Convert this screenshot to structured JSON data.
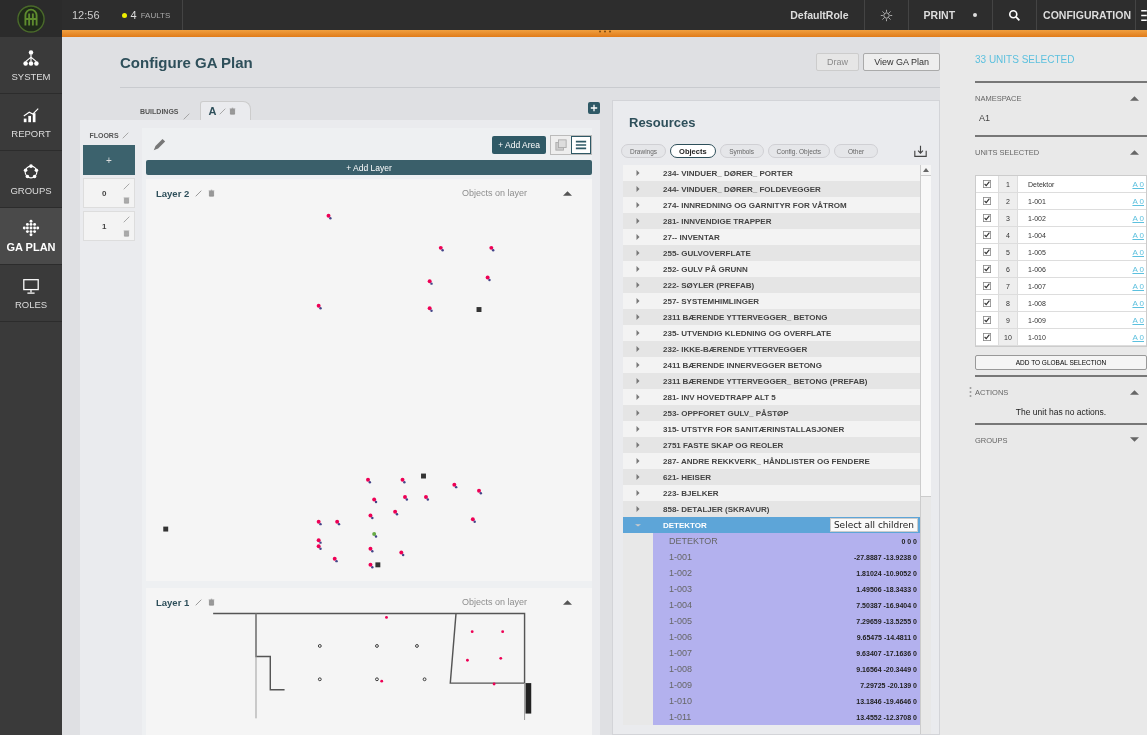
{
  "topbar": {
    "time": "12:56",
    "faults": {
      "count": "4",
      "label": "FAULTS"
    },
    "role": "DefaultRole",
    "print": "PRINT",
    "configuration": "CONFIGURATION"
  },
  "nav": [
    {
      "label": "SYSTEM",
      "kind": "system",
      "selected": false
    },
    {
      "label": "REPORT",
      "kind": "report",
      "selected": false
    },
    {
      "label": "GROUPS",
      "kind": "groups",
      "selected": false
    },
    {
      "label": "GA PLAN",
      "kind": "gaplan",
      "selected": true
    },
    {
      "label": "ROLES",
      "kind": "roles",
      "selected": false
    }
  ],
  "page": {
    "title": "Configure GA Plan",
    "buttons": [
      {
        "label": "Draw",
        "disabled": true
      },
      {
        "label": "View GA Plan",
        "disabled": false
      }
    ]
  },
  "buildings": {
    "label": "BUILDINGS",
    "tabs": [
      {
        "label": "A",
        "selected": true
      }
    ]
  },
  "floors": {
    "label": "FLOORS",
    "add": "+",
    "items": [
      {
        "label": "0"
      },
      {
        "label": "1"
      }
    ]
  },
  "toolbar": {
    "add_area": "+ Add Area",
    "add_layer": "+ Add Layer",
    "view_modes": [
      {
        "kind": "copy",
        "selected": false
      },
      {
        "kind": "list",
        "selected": true
      }
    ]
  },
  "layers": [
    {
      "name": "Layer 2",
      "hint": "Objects on layer",
      "expanded": true,
      "kind": "markers"
    },
    {
      "name": "Layer 1",
      "hint": "Objects on layer",
      "expanded": true,
      "kind": "plan"
    }
  ],
  "resources": {
    "title": "Resources",
    "tabs": [
      {
        "label": "Drawings",
        "selected": false
      },
      {
        "label": "Objects",
        "selected": true
      },
      {
        "label": "Symbols",
        "selected": false
      },
      {
        "label": "Config. Objects",
        "selected": false
      },
      {
        "label": "Other",
        "selected": false
      }
    ],
    "items": [
      {
        "name": "234- VINDUER_ DØRER_ PORTER",
        "expanded": false
      },
      {
        "name": "244- VINDUER_ DØRER_ FOLDEVEGGER",
        "expanded": false
      },
      {
        "name": "274- INNREDNING OG GARNITYR FOR VÅTROM",
        "expanded": false
      },
      {
        "name": "281- INNVENDIGE TRAPPER",
        "expanded": false
      },
      {
        "name": "27-- INVENTAR",
        "expanded": false
      },
      {
        "name": "255- GULVOVERFLATE",
        "expanded": false
      },
      {
        "name": "252- GULV PÅ GRUNN",
        "expanded": false
      },
      {
        "name": "222- SØYLER (PREFAB)",
        "expanded": false
      },
      {
        "name": "257- SYSTEMHIMLINGER",
        "expanded": false
      },
      {
        "name": "2311 BÆRENDE YTTERVEGGER_ BETONG",
        "expanded": false
      },
      {
        "name": "235- UTVENDIG KLEDNING OG OVERFLATE",
        "expanded": false
      },
      {
        "name": "232- IKKE-BÆRENDE YTTERVEGGER",
        "expanded": false
      },
      {
        "name": "2411 BÆRENDE INNERVEGGER BETONG",
        "expanded": false
      },
      {
        "name": "2311 BÆRENDE YTTERVEGGER_ BETONG (PREFAB)",
        "expanded": false
      },
      {
        "name": "281- INV HOVEDTRAPP ALT 5",
        "expanded": false
      },
      {
        "name": "253- OPPFORET GULV_ PÅSTØP",
        "expanded": false
      },
      {
        "name": "315- UTSTYR FOR SANITÆRINSTALLASJONER",
        "expanded": false
      },
      {
        "name": "2751 FASTE SKAP OG REOLER",
        "expanded": false
      },
      {
        "name": "287- ANDRE REKKVERK_ HÅNDLISTER OG FENDERE",
        "expanded": false
      },
      {
        "name": "621- HEISER",
        "expanded": false
      },
      {
        "name": "223- BJELKER",
        "expanded": false
      },
      {
        "name": "858- DETALJER (SKRAVUR)",
        "expanded": false
      },
      {
        "name": "DETEKTOR",
        "expanded": true,
        "action": "Select all children",
        "children": [
          {
            "name": "DETEKTOR",
            "coords": "0 0 0"
          },
          {
            "name": "1-001",
            "coords": "-27.8887 -13.9238 0"
          },
          {
            "name": "1-002",
            "coords": "1.81024 -10.9052 0"
          },
          {
            "name": "1-003",
            "coords": "1.49506 -18.3433 0"
          },
          {
            "name": "1-004",
            "coords": "7.50387 -16.9404 0"
          },
          {
            "name": "1-005",
            "coords": "7.29659 -13.5255 0"
          },
          {
            "name": "1-006",
            "coords": "9.65475 -14.4811 0"
          },
          {
            "name": "1-007",
            "coords": "9.63407 -17.1636 0"
          },
          {
            "name": "1-008",
            "coords": "9.16564 -20.3449 0"
          },
          {
            "name": "1-009",
            "coords": "7.29725 -20.139 0"
          },
          {
            "name": "1-010",
            "coords": "13.1846 -19.4646 0"
          },
          {
            "name": "1-011",
            "coords": "13.4552 -12.3708 0"
          }
        ]
      }
    ]
  },
  "selection": {
    "title": "33 UNITS SELECTED",
    "namespace": {
      "label": "NAMESPACE",
      "expanded": true,
      "value": "A1"
    },
    "units": {
      "label": "UNITS SELECTED",
      "expanded": true,
      "rows": [
        {
          "checked": true,
          "index": "1",
          "name": "Detektor",
          "link": "A 0"
        },
        {
          "checked": true,
          "index": "2",
          "name": "1-001",
          "link": "A 0"
        },
        {
          "checked": true,
          "index": "3",
          "name": "1-002",
          "link": "A 0"
        },
        {
          "checked": true,
          "index": "4",
          "name": "1-004",
          "link": "A 0"
        },
        {
          "checked": true,
          "index": "5",
          "name": "1-005",
          "link": "A 0"
        },
        {
          "checked": true,
          "index": "6",
          "name": "1-006",
          "link": "A 0"
        },
        {
          "checked": true,
          "index": "7",
          "name": "1-007",
          "link": "A 0"
        },
        {
          "checked": true,
          "index": "8",
          "name": "1-008",
          "link": "A 0"
        },
        {
          "checked": true,
          "index": "9",
          "name": "1-009",
          "link": "A 0"
        },
        {
          "checked": true,
          "index": "10",
          "name": "1-010",
          "link": "A 0"
        }
      ],
      "button": "ADD TO GLOBAL SELECTION"
    },
    "actions": {
      "label": "ACTIONS",
      "expanded": true,
      "text": "The unit has no actions."
    },
    "groups": {
      "label": "GROUPS",
      "expanded": false
    }
  }
}
